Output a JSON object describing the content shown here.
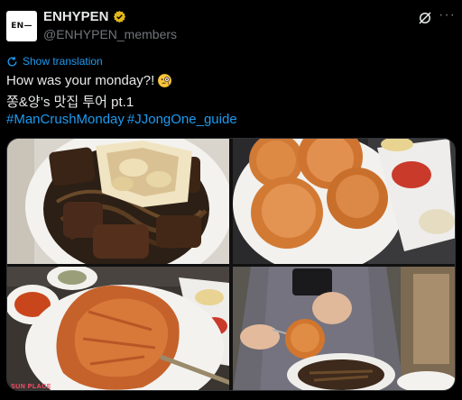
{
  "post": {
    "author": {
      "avatar_text": "EN—",
      "display_name": "ENHYPEN",
      "handle": "@ENHYPEN_members",
      "verified_icon": "verified-badge-icon"
    },
    "actions": {
      "grok_icon": "grok-icon",
      "more_icon": "more-icon"
    },
    "translate": {
      "label": "Show translation",
      "icon": "translate-icon"
    },
    "text": {
      "line1": "How was your monday?!",
      "line1_emoji": "monocle-face-icon",
      "line2": "쫑&양’s 맛집 투어 pt.1",
      "hashtag1": "#ManCrushMonday",
      "hashtag2": "#JJongOne_guide"
    },
    "media": {
      "photos": [
        {
          "subject": "steak-and-noodles-photo"
        },
        {
          "subject": "fried-buns-photo"
        },
        {
          "subject": "large-fried-pastry-photo"
        },
        {
          "subject": "holding-food-with-phone-photo"
        }
      ],
      "watermark": "SUN PLACE"
    }
  },
  "colors": {
    "background": "#000000",
    "text": "#e7e9ea",
    "secondary": "#71767b",
    "link": "#1d9bf0",
    "verified": "#e2b719"
  }
}
